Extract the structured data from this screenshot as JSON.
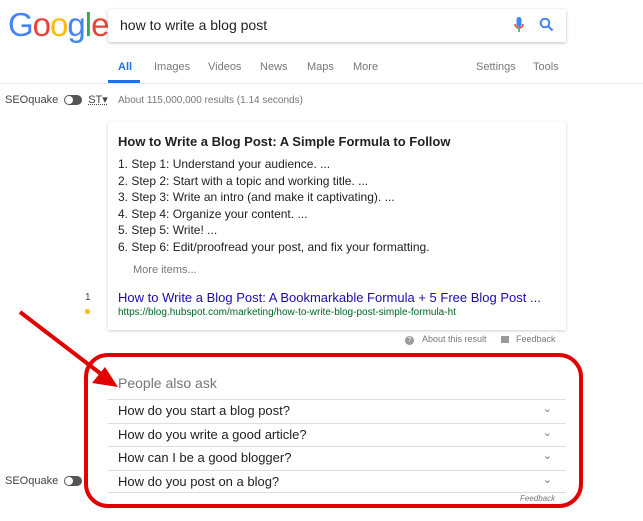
{
  "logo": {
    "text": "Google",
    "colors": [
      "#4285f4",
      "#ea4335",
      "#fbbc05",
      "#4285f4",
      "#34a853",
      "#ea4335"
    ]
  },
  "search": {
    "query": "how to write a blog post"
  },
  "tabs": [
    "All",
    "Images",
    "Videos",
    "News",
    "Maps",
    "More"
  ],
  "tools": [
    "Settings",
    "Tools"
  ],
  "seoquake": {
    "label": "SEOquake",
    "st": "ST▾"
  },
  "stats": "About 115,000,000 results (1.14 seconds)",
  "snippet": {
    "title": "How to Write a Blog Post: A Simple Formula to Follow",
    "steps": [
      "1. Step 1: Understand your audience. ...",
      "2. Step 2: Start with a topic and working title. ...",
      "3. Step 3: Write an intro (and make it captivating). ...",
      "4. Step 4: Organize your content. ...",
      "5. Step 5: Write! ...",
      "6. Step 6: Edit/proofread your post, and fix your formatting."
    ],
    "more": "More items...",
    "rank": "1",
    "link": "How to Write a Blog Post: A Bookmarkable Formula + 5 Free Blog Post ...",
    "url": "https://blog.hubspot.com/marketing/how-to-write-blog-post-simple-formula-ht"
  },
  "about": "About this result",
  "feedback": "Feedback",
  "paa": {
    "heading": "People also ask",
    "questions": [
      "How do you start a blog post?",
      "How do you write a good article?",
      "How can I be a good blogger?",
      "How do you post on a blog?"
    ],
    "feedback": "Feedback"
  },
  "annotation_color": "#e00000"
}
